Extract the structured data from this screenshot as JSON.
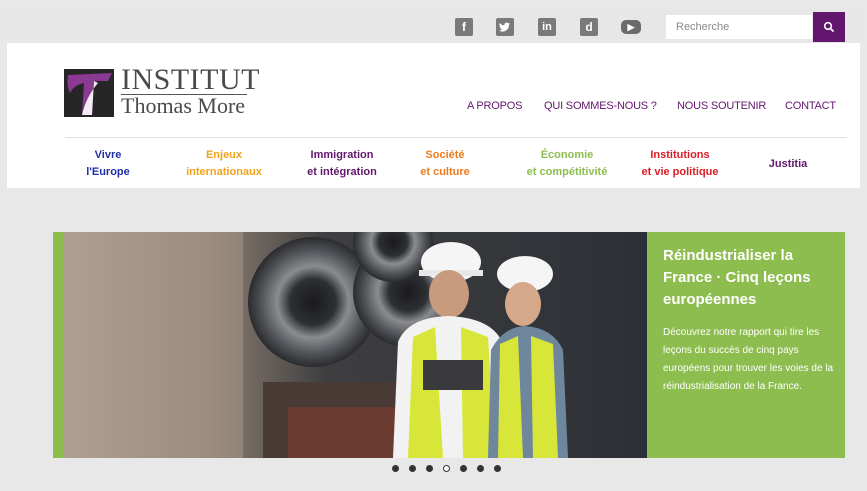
{
  "social": [
    {
      "name": "facebook",
      "glyph": "f"
    },
    {
      "name": "twitter",
      "glyph": ""
    },
    {
      "name": "linkedin",
      "glyph": "in"
    },
    {
      "name": "dailymotion",
      "glyph": "d"
    },
    {
      "name": "youtube",
      "glyph": "▶"
    }
  ],
  "search": {
    "placeholder": "Recherche"
  },
  "logo": {
    "line1": "INSTITUT",
    "line2": "Thomas More"
  },
  "main_nav": [
    "A PROPOS",
    "QUI SOMMES-NOUS ?",
    "NOUS SOUTENIR",
    "CONTACT"
  ],
  "categories": [
    {
      "line1": "Vivre",
      "line2": "l'Europe",
      "color": "#1f2fa6"
    },
    {
      "line1": "Enjeux",
      "line2": "internationaux",
      "color": "#f2a31c"
    },
    {
      "line1": "Immigration",
      "line2": "et intégration",
      "color": "#62166d"
    },
    {
      "line1": "Société",
      "line2": "et culture",
      "color": "#ef7b1a"
    },
    {
      "line1": "Économie",
      "line2": "et compétitivité",
      "color": "#8ebd4f"
    },
    {
      "line1": "Institutions",
      "line2": "et vie politique",
      "color": "#d81f26"
    },
    {
      "line1": "Justitia",
      "line2": "",
      "color": "#62166d"
    }
  ],
  "hero": {
    "title": "Réindustrialiser la France · Cinq leçons européennes",
    "text": "Découvrez notre rapport qui tire les leçons du succès de cinq pays européens pour trouver les voies de la réindustrialisation de la France.",
    "slide_count": 7,
    "active_slide": 4
  },
  "colors": {
    "brand": "#62166d",
    "hero_green": "#8ebd4f"
  }
}
